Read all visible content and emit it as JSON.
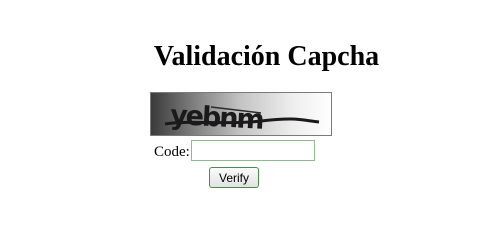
{
  "page": {
    "title": "Validación Capcha"
  },
  "captcha": {
    "text": "yebnm"
  },
  "form": {
    "code_label": "Code:",
    "code_value": "",
    "code_placeholder": "",
    "verify_label": "Verify"
  },
  "colors": {
    "background": "#ffffff",
    "captcha_text": "#1a1a1a",
    "input_border": "#8fb98f",
    "button_border": "#4e8a4e"
  }
}
